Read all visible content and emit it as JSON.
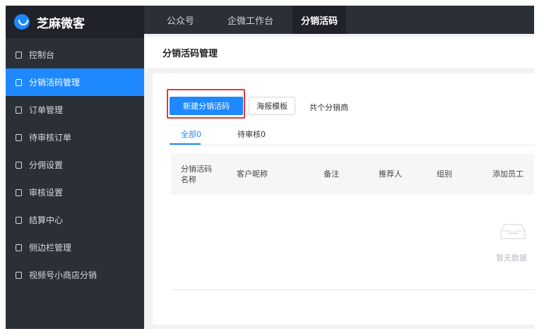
{
  "app": {
    "logo_text": "芝麻微客"
  },
  "sidebar": {
    "items": [
      {
        "label": "控制台",
        "active": false
      },
      {
        "label": "分销活码管理",
        "active": true
      },
      {
        "label": "订单管理",
        "active": false
      },
      {
        "label": "待审核订单",
        "active": false
      },
      {
        "label": "分佣设置",
        "active": false
      },
      {
        "label": "审核设置",
        "active": false
      },
      {
        "label": "结算中心",
        "active": false
      },
      {
        "label": "侧边栏管理",
        "active": false
      },
      {
        "label": "视频号小商店分销",
        "active": false
      }
    ]
  },
  "topnav": {
    "items": [
      "公众号",
      "企微工作台",
      "分销活码"
    ],
    "active_index": 2
  },
  "header": {
    "title": "分销活码管理"
  },
  "toolbar": {
    "new_button": "新建分销活码",
    "poster_button": "海报模板",
    "count_text": "共个分销商"
  },
  "tabs": {
    "all": "全部0",
    "pending": "待审核0"
  },
  "table": {
    "columns": [
      "分销活码\n名称",
      "客户昵称",
      "备注",
      "推荐人",
      "组别",
      "添加员工"
    ],
    "empty_text": "暂无数据"
  },
  "colors": {
    "accent": "#1e88ff",
    "sidebar_bg": "#2b3036",
    "highlight_box": "#e53935"
  }
}
